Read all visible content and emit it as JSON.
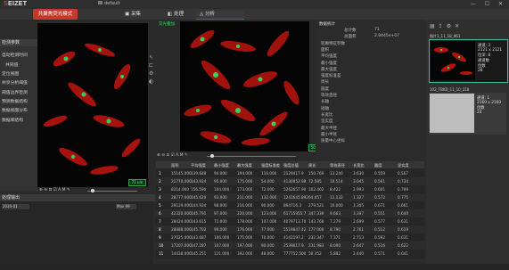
{
  "app": {
    "logo_prefix": "S",
    "logo_rest": "EIZET",
    "project_name": "default",
    "mode_button": "共聚焦荧光模式",
    "tabs": [
      "采集",
      "处理",
      "分析"
    ],
    "active_tab": 2,
    "window_controls": "— ☐ ✕"
  },
  "left_panel": {
    "header": "检测参数",
    "items": [
      "自动检测时间",
      "共同值",
      "定位视图",
      "共享分析阈值",
      "阈值边界检测",
      "预测数据结构",
      "数据视图分布",
      "数据库结构"
    ]
  },
  "images": {
    "small_label": "荧光叠加",
    "scale_left": "71 um",
    "scale_right": "50 um",
    "toolbar_label": "A.M"
  },
  "data_panel": {
    "header": "数据统计",
    "rows": [
      {
        "label": "总计数",
        "value": "71"
      },
      {
        "label": "总面积",
        "value": "2.8445e+07"
      },
      {
        "label": "轮廓特征参数",
        "value": ""
      },
      {
        "label": "面积",
        "value": ""
      },
      {
        "label": "平均强度",
        "value": ""
      },
      {
        "label": "最小强度",
        "value": ""
      },
      {
        "label": "最大强度",
        "value": ""
      },
      {
        "label": "强度标准差",
        "value": ""
      },
      {
        "label": "周长",
        "value": ""
      },
      {
        "label": "圆度",
        "value": ""
      },
      {
        "label": "等效直径",
        "value": ""
      },
      {
        "label": "长轴",
        "value": ""
      },
      {
        "label": "短轴",
        "value": ""
      },
      {
        "label": "长宽比",
        "value": ""
      },
      {
        "label": "坚实度",
        "value": ""
      },
      {
        "label": "最大半径",
        "value": ""
      },
      {
        "label": "最小半径",
        "value": ""
      },
      {
        "label": "质量中心坐标",
        "value": ""
      }
    ]
  },
  "table": {
    "headers": [
      "",
      "面积",
      "平均强度",
      "最小强度",
      "最大强度",
      "强度标准差",
      "强度总值",
      "周长",
      "等效直径",
      "长宽比",
      "圆度",
      "坚实度"
    ],
    "rows": [
      [
        "1",
        "15145.000",
        "139.648",
        "94.000",
        "194.000",
        "116.000",
        "2129417.9",
        "150.769",
        "13.240",
        "3.630",
        "0.559",
        "0.567"
      ],
      [
        "2",
        "21770.000",
        "143.924",
        "95.000",
        "175.000",
        "54.000",
        "4130052.98",
        "72.585",
        "10.514",
        "3.045",
        "0.561",
        "0.734"
      ],
      [
        "3",
        "8314.000",
        "156.590",
        "104.000",
        "173.000",
        "72.000",
        "5262657.90",
        "102.402",
        "8.422",
        "2.993",
        "0.601",
        "0.799"
      ],
      [
        "4",
        "28777.000",
        "145.620",
        "93.000",
        "211.000",
        "132.000",
        "1241645.892",
        "64.057",
        "11.132",
        "1.327",
        "0.572",
        "0.775"
      ],
      [
        "5",
        "29129.000",
        "144.924",
        "98.000",
        "216.000",
        "90.000",
        "864716.3",
        "279.521",
        "10.000",
        "3.305",
        "0.671",
        "0.661"
      ],
      [
        "6",
        "42320.000",
        "145.791",
        "97.000",
        "220.000",
        "123.000",
        "61715955.7",
        "347.339",
        "9.663",
        "3.397",
        "0.551",
        "0.640"
      ],
      [
        "7",
        "28424.000",
        "143.615",
        "71.000",
        "178.000",
        "107.000",
        "4079713.70",
        "143.768",
        "7.279",
        "2.699",
        "0.577",
        "0.631"
      ],
      [
        "8",
        "28888.000",
        "145.702",
        "99.000",
        "176.000",
        "77.000",
        "5519847.42",
        "177.000",
        "8.790",
        "2.761",
        "0.512",
        "0.619"
      ],
      [
        "9",
        "27025.000",
        "143.687",
        "106.000",
        "175.000",
        "70.000",
        "4142197.2",
        "232.347",
        "7.371",
        "2.713",
        "0.592",
        "0.631"
      ],
      [
        "10",
        "17207.000",
        "147.287",
        "107.000",
        "197.000",
        "90.000",
        "2539817.9",
        "231.983",
        "8.090",
        "2.647",
        "0.516",
        "0.622"
      ],
      [
        "11",
        "14438.000",
        "145.251",
        "121.000",
        "192.000",
        "48.000",
        "777752.500",
        "50.352",
        "5.882",
        "2.440",
        "0.571",
        "0.641"
      ]
    ]
  },
  "right_panel": {
    "thumbs": [
      {
        "title": "图片1_11_18_461",
        "info": [
          "通道: 3",
          "2121 x 2121",
          "位深: 8",
          "通道数",
          "位数",
          "28"
        ]
      },
      {
        "title": "102_TBKD_11_10_218",
        "info": [
          "通道: 1",
          "2160 x 2160",
          "",
          "位数",
          "24"
        ]
      }
    ]
  },
  "log_panel": {
    "header": "处理输出",
    "select_value": "2020-01",
    "range_value": "Max 99"
  }
}
